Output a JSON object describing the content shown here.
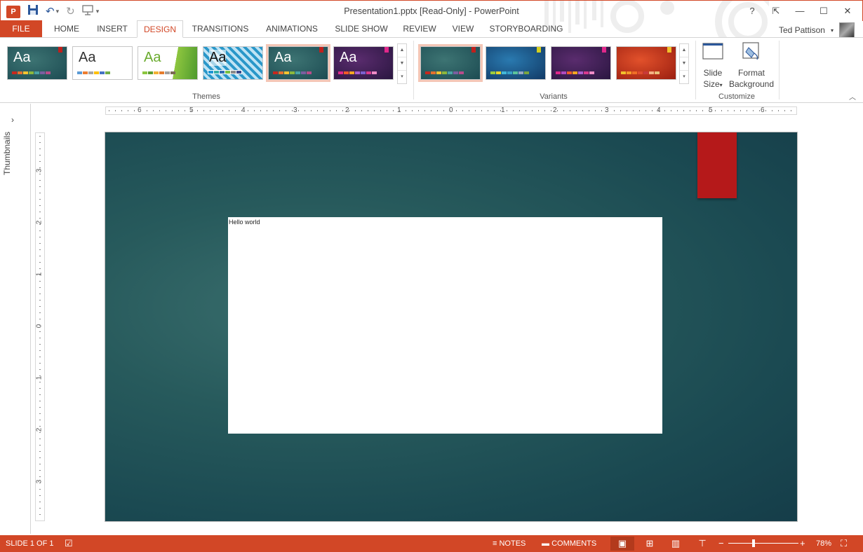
{
  "titlebar": {
    "title": "Presentation1.pptx [Read-Only] - PowerPoint",
    "app_icon_text": "P",
    "help": "?",
    "restore_ribbon": "⇱",
    "minimize": "—",
    "maximize": "☐",
    "close": "✕"
  },
  "tabs": {
    "file": "FILE",
    "home": "HOME",
    "insert": "INSERT",
    "design": "DESIGN",
    "transitions": "TRANSITIONS",
    "animations": "ANIMATIONS",
    "slideshow": "SLIDE SHOW",
    "review": "REVIEW",
    "view": "VIEW",
    "storyboarding": "STORYBOARDING"
  },
  "user": {
    "name": "Ted Pattison"
  },
  "ribbon": {
    "themes_label": "Themes",
    "variants_label": "Variants",
    "customize_label": "Customize",
    "theme_aa": "Aa",
    "slide_size_line1": "Slide",
    "slide_size_line2": "Size",
    "format_bg_line1": "Format",
    "format_bg_line2": "Background"
  },
  "leftpane": {
    "label": "Thumbnails"
  },
  "rulers": {
    "h": [
      "6",
      "5",
      "4",
      "3",
      "2",
      "1",
      "0",
      "1",
      "2",
      "3",
      "4",
      "5",
      "6"
    ],
    "v": [
      "3",
      "2",
      "1",
      "0",
      "1",
      "2",
      "3"
    ]
  },
  "slide": {
    "textbox_text": "Hello world"
  },
  "statusbar": {
    "slide_info": "SLIDE 1 OF 1",
    "notes": "NOTES",
    "comments": "COMMENTS",
    "zoom": "78%",
    "zoom_minus": "−",
    "zoom_plus": "+"
  },
  "colors": {
    "accent": "#d24726",
    "slide_bg": "#1b4a52",
    "slide_flag": "#b5191a"
  }
}
